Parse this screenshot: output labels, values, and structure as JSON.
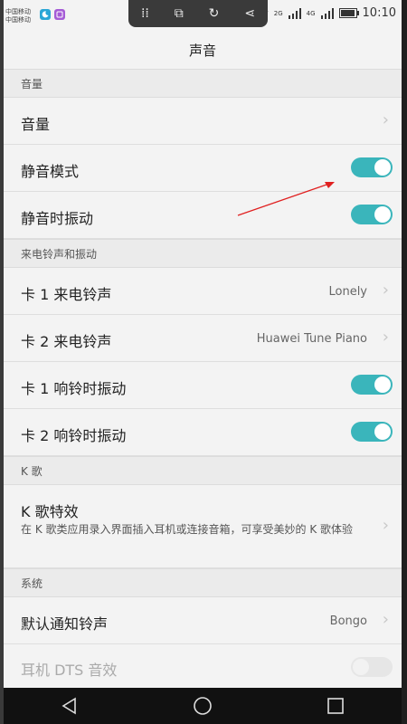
{
  "status_bar": {
    "carrier1": "中国移动",
    "carrier2": "中国移动",
    "time": "10:10",
    "sig1": "2G",
    "sig2": "4G"
  },
  "title": "声音",
  "sections": {
    "volume": "音量",
    "ringtone": "来电铃声和振动",
    "karaoke": "K 歌",
    "system": "系统"
  },
  "rows": {
    "volume": {
      "label": "音量"
    },
    "silent_mode": {
      "label": "静音模式",
      "on": true
    },
    "vibrate_silent": {
      "label": "静音时振动",
      "on": true
    },
    "card1_ringtone": {
      "label": "卡 1 来电铃声",
      "value": "Lonely"
    },
    "card2_ringtone": {
      "label": "卡 2 来电铃声",
      "value": "Huawei Tune Piano"
    },
    "card1_vibrate": {
      "label": "卡 1 响铃时振动",
      "on": true
    },
    "card2_vibrate": {
      "label": "卡 2 响铃时振动",
      "on": true
    },
    "karaoke_effect": {
      "label": "K 歌特效",
      "desc": "在 K 歌类应用录入界面插入耳机或连接音箱，可享受美妙的 K 歌体验"
    },
    "default_notification": {
      "label": "默认通知铃声",
      "value": "Bongo"
    },
    "headphone_dts": {
      "label": "耳机 DTS 音效",
      "on": false,
      "enabled": false
    }
  },
  "colors": {
    "toggle_on": "#3ab5bb",
    "annotation_arrow": "#e02020"
  },
  "icons": {
    "chevron": "chevron-right-icon",
    "nav_back": "back-triangle-icon",
    "nav_home": "home-circle-icon",
    "nav_recents": "recents-square-icon"
  }
}
